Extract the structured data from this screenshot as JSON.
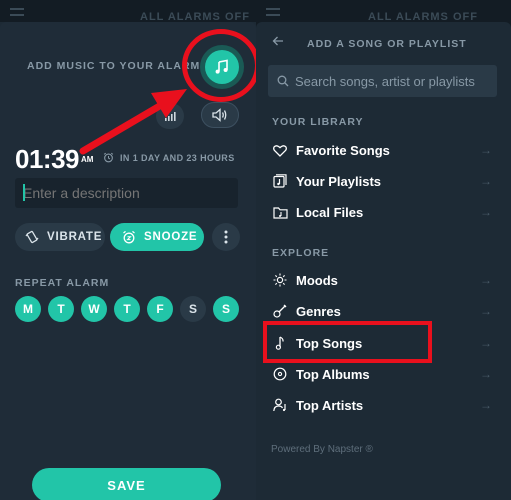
{
  "left_panel": {
    "header_text": "ALL ALARMS OFF",
    "add_music_label": "ADD MUSIC TO YOUR ALARM",
    "time": "01:39",
    "ampm": "AM",
    "in_time_label": "IN 1 DAY AND 23 HOURS",
    "description_placeholder": "Enter a description",
    "vibrate_label": "VIBRATE",
    "snooze_label": "SNOOZE",
    "repeat_label": "REPEAT ALARM",
    "days": [
      {
        "label": "M",
        "active": true
      },
      {
        "label": "T",
        "active": true
      },
      {
        "label": "W",
        "active": true
      },
      {
        "label": "T",
        "active": true
      },
      {
        "label": "F",
        "active": true
      },
      {
        "label": "S",
        "active": false
      },
      {
        "label": "S",
        "active": true
      }
    ],
    "save_label": "SAVE"
  },
  "right_panel": {
    "header_text": "ALL ALARMS OFF",
    "title": "ADD A SONG OR PLAYLIST",
    "search_placeholder": "Search songs, artist or playlists",
    "library_heading": "YOUR LIBRARY",
    "library_items": [
      {
        "label": "Favorite Songs",
        "icon": "heart-icon"
      },
      {
        "label": "Your Playlists",
        "icon": "playlist-icon"
      },
      {
        "label": "Local Files",
        "icon": "folder-icon"
      }
    ],
    "explore_heading": "EXPLORE",
    "explore_items": [
      {
        "label": "Moods",
        "icon": "sun-icon"
      },
      {
        "label": "Genres",
        "icon": "guitar-icon"
      },
      {
        "label": "Top Songs",
        "icon": "music-note-icon"
      },
      {
        "label": "Top Albums",
        "icon": "album-icon"
      },
      {
        "label": "Top Artists",
        "icon": "artist-icon"
      }
    ],
    "powered_by": "Powered By Napster ®"
  },
  "colors": {
    "accent": "#22c5a8",
    "highlight_red": "#e9101d",
    "panel_bg": "#1f2c38",
    "chip_bg": "#2a3a47"
  }
}
